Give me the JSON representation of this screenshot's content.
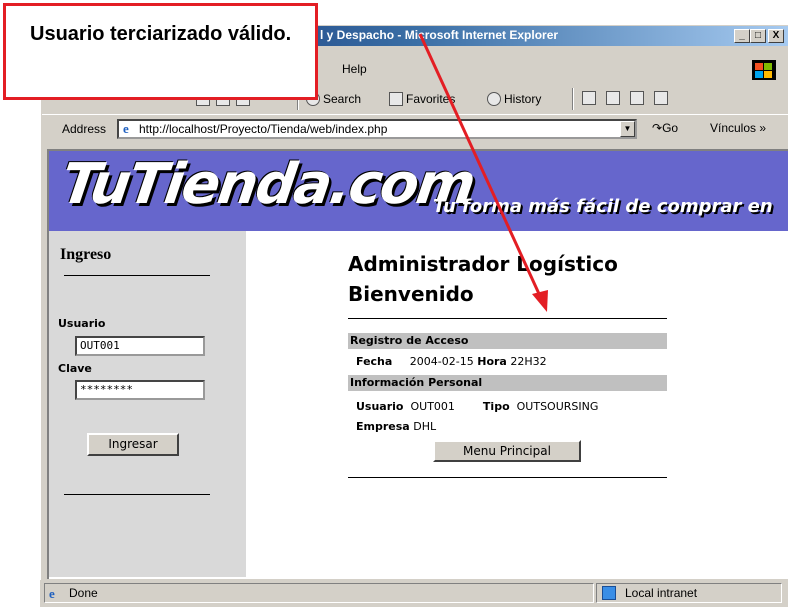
{
  "window": {
    "title_visible": "l y Despacho - Microsoft Internet Explorer",
    "buttons": {
      "minimize": "_",
      "maximize": "□",
      "close": "X"
    }
  },
  "menubar": {
    "help": "Help"
  },
  "toolbar": {
    "search": "Search",
    "favorites": "Favorites",
    "history": "History"
  },
  "addressbar": {
    "label": "Address",
    "url": "http://localhost/Proyecto/Tienda/web/index.php",
    "go": "Go",
    "links": "Vínculos »"
  },
  "banner": {
    "logo": "TuTienda.com",
    "tagline": "Tu forma más fácil de comprar en"
  },
  "login": {
    "heading": "Ingreso",
    "user_label": "Usuario",
    "user_value": "OUT001",
    "password_label": "Clave",
    "password_value": "********",
    "button": "Ingresar"
  },
  "main": {
    "title_line1": "Administrador Logístico",
    "title_line2": "Bienvenido",
    "access_section": "Registro de Acceso",
    "date_label": "Fecha",
    "date_value": "2004-02-15",
    "time_label": "Hora",
    "time_value": "22H32",
    "personal_section": "Información Personal",
    "user_label": "Usuario",
    "user_value": "OUT001",
    "type_label": "Tipo",
    "type_value": "OUTSOURSING",
    "company_label": "Empresa",
    "company_value": "DHL",
    "menu_button": "Menu Principal"
  },
  "status": {
    "left": "Done",
    "zone": "Local intranet"
  },
  "annotation": {
    "text": "Usuario terciarizado válido.",
    "color": "#e31e24"
  },
  "colors": {
    "banner": "#6666cc",
    "sidebar": "#d9d9d9",
    "section": "#c0c0c0",
    "titlebar": "#0a246a"
  }
}
